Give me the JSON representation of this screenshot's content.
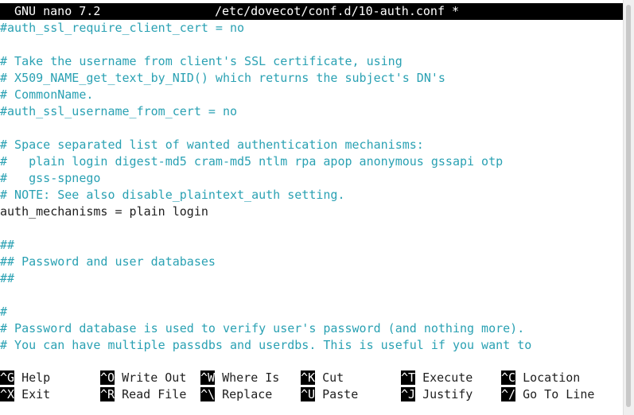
{
  "titlebar": {
    "app": "GNU nano 7.2",
    "file": "/etc/dovecot/conf.d/10-auth.conf *"
  },
  "editor": {
    "lines": [
      {
        "text": "#auth_ssl_require_client_cert = no",
        "type": "comment"
      },
      {
        "text": "",
        "type": "blank"
      },
      {
        "text": "# Take the username from client's SSL certificate, using",
        "type": "comment"
      },
      {
        "text": "# X509_NAME_get_text_by_NID() which returns the subject's DN's",
        "type": "comment"
      },
      {
        "text": "# CommonName.",
        "type": "comment"
      },
      {
        "text": "#auth_ssl_username_from_cert = no",
        "type": "comment"
      },
      {
        "text": "",
        "type": "blank"
      },
      {
        "text": "# Space separated list of wanted authentication mechanisms:",
        "type": "comment"
      },
      {
        "text": "#   plain login digest-md5 cram-md5 ntlm rpa apop anonymous gssapi otp",
        "type": "comment"
      },
      {
        "text": "#   gss-spnego",
        "type": "comment"
      },
      {
        "text": "# NOTE: See also disable_plaintext_auth setting.",
        "type": "comment"
      },
      {
        "text": "auth_mechanisms = plain login",
        "type": "code"
      },
      {
        "text": "",
        "type": "blank"
      },
      {
        "text": "##",
        "type": "comment"
      },
      {
        "text": "## Password and user databases",
        "type": "comment"
      },
      {
        "text": "##",
        "type": "comment"
      },
      {
        "text": "",
        "type": "blank"
      },
      {
        "text": "#",
        "type": "comment"
      },
      {
        "text": "# Password database is used to verify user's password (and nothing more).",
        "type": "comment"
      },
      {
        "text": "# You can have multiple passdbs and userdbs. This is useful if you want to",
        "type": "comment"
      }
    ]
  },
  "shortcuts": [
    [
      {
        "key": "^G",
        "label": "Help"
      },
      {
        "key": "^O",
        "label": "Write Out"
      },
      {
        "key": "^W",
        "label": "Where Is"
      },
      {
        "key": "^K",
        "label": "Cut"
      },
      {
        "key": "^T",
        "label": "Execute"
      },
      {
        "key": "^C",
        "label": "Location"
      }
    ],
    [
      {
        "key": "^X",
        "label": "Exit"
      },
      {
        "key": "^R",
        "label": "Read File"
      },
      {
        "key": "^\\",
        "label": "Replace"
      },
      {
        "key": "^U",
        "label": "Paste"
      },
      {
        "key": "^J",
        "label": "Justify"
      },
      {
        "key": "^/",
        "label": "Go To Line"
      }
    ]
  ],
  "colors": {
    "comment": "#2aa1b3",
    "text": "#1e1e1e",
    "titlebar_bg": "#000000",
    "titlebar_fg": "#ffffff"
  }
}
